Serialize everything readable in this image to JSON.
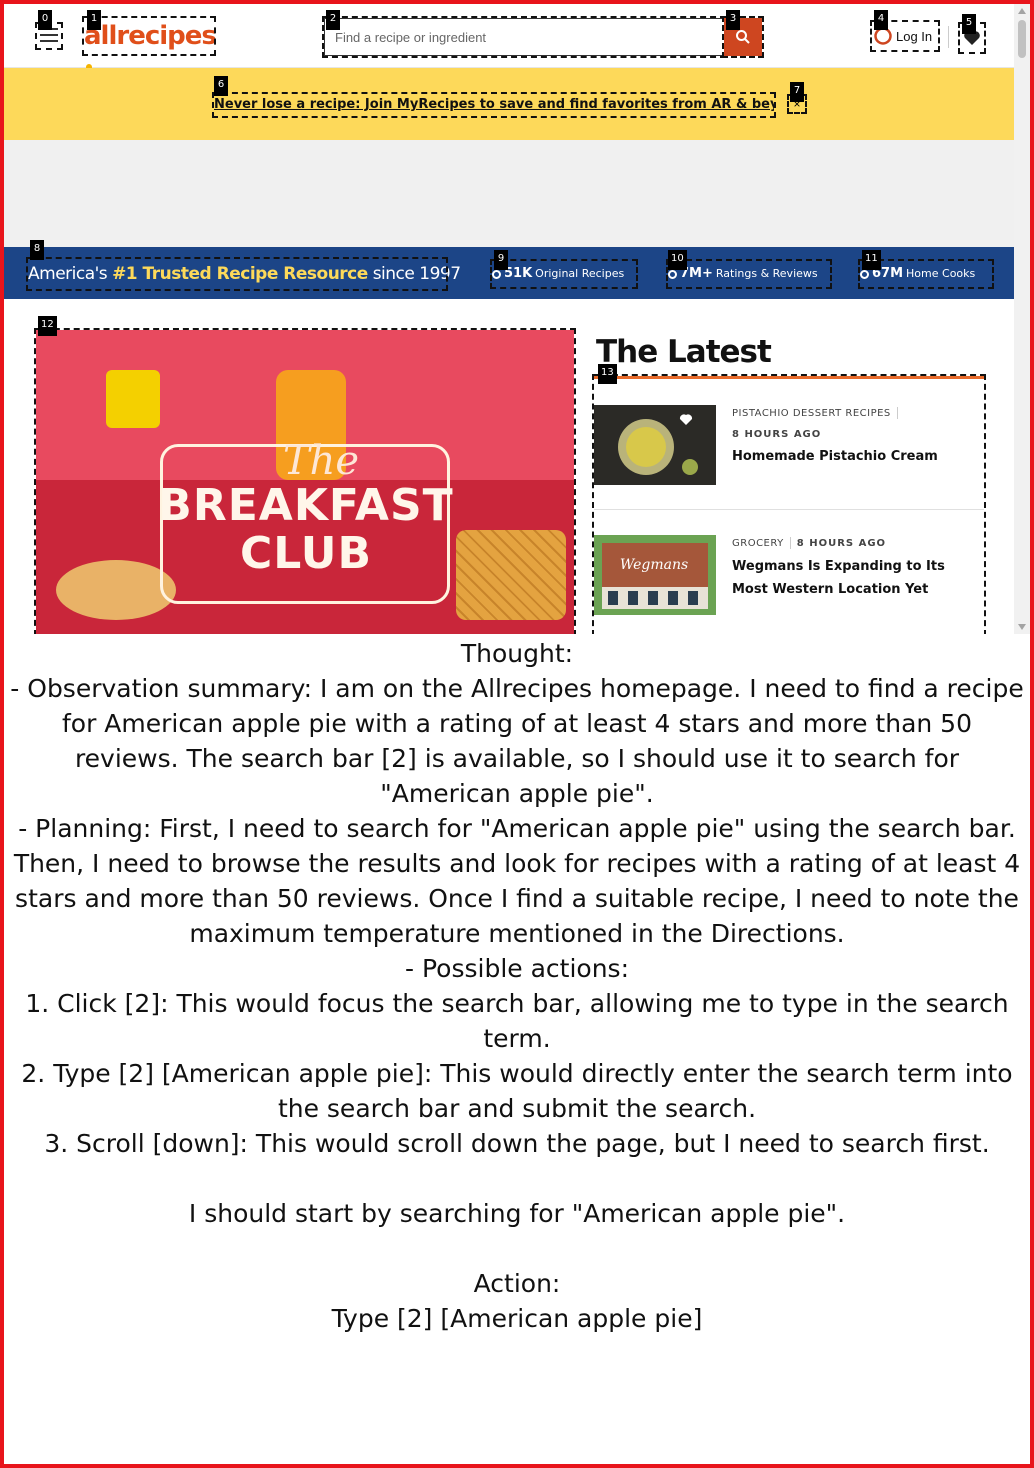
{
  "header": {
    "logo_text": "allrecipes",
    "search_placeholder": "Find a recipe or ingredient",
    "login_label": "Log In"
  },
  "promo": {
    "text": "Never lose a recipe: Join MyRecipes to save and find favorites from AR & beyond",
    "close_glyph": "×"
  },
  "stats": {
    "trusted_prefix": "America's ",
    "trusted_bold": "#1 Trusted Recipe Resource",
    "trusted_suffix": " since 1997",
    "items": [
      {
        "num": "51K",
        "label": "Original Recipes"
      },
      {
        "num": "7M+",
        "label": "Ratings & Reviews"
      },
      {
        "num": "67M",
        "label": "Home Cooks"
      }
    ]
  },
  "hero": {
    "title_the": "The",
    "title_breakfast": "BREAKFAST",
    "title_club": "CLUB"
  },
  "latest": {
    "heading": "The Latest",
    "cards": [
      {
        "category": "PISTACHIO DESSERT RECIPES",
        "time": "8 HOURS AGO",
        "title": "Homemade Pistachio Cream"
      },
      {
        "category": "GROCERY",
        "time": "8 HOURS AGO",
        "title": "Wegmans Is Expanding to Its Most Western Location Yet",
        "image_text": "Wegmans"
      }
    ]
  },
  "tags": [
    "0",
    "1",
    "2",
    "3",
    "4",
    "5",
    "6",
    "7",
    "8",
    "9",
    "10",
    "11",
    "12",
    "13"
  ],
  "annotation": "Thought:\n- Observation summary: I am on the Allrecipes homepage. I need to find a recipe for American apple pie with a rating of at least 4 stars and more than 50 reviews. The search bar [2] is available, so I should use it to search for \"American apple pie\".\n- Planning: First, I need to search for \"American apple pie\" using the search bar. Then, I need to browse the results and look for recipes with a rating of at least 4 stars and more than 50 reviews. Once I find a suitable recipe, I need to note the maximum temperature mentioned in the Directions.\n- Possible actions:\n1. Click [2]: This would focus the search bar, allowing me to type in the search term.\n2. Type [2] [American apple pie]: This would directly enter the search term into the search bar and submit the search.\n3. Scroll [down]: This would scroll down the page, but I need to search first.\n\nI should start by searching for \"American apple pie\".\n\nAction:\nType [2] [American apple pie]",
  "colors": {
    "brand": "#ce4620",
    "banner": "#fdd95a",
    "statsbar": "#1c4587",
    "frame": "#e8141b"
  }
}
